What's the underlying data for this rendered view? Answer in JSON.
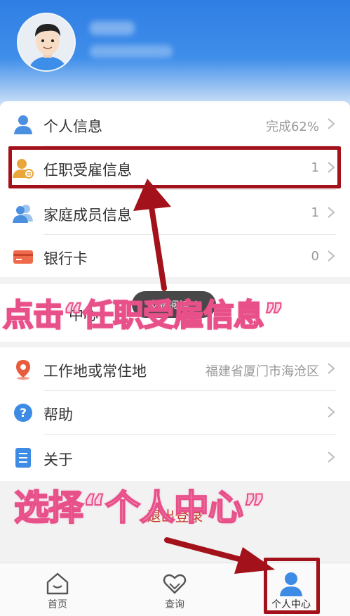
{
  "header": {
    "avatar": "user-avatar"
  },
  "menu_group1": [
    {
      "label": "个人信息",
      "value": "完成62%",
      "icon": "person-icon"
    },
    {
      "label": "任职受雇信息",
      "value": "1",
      "icon": "employment-icon"
    },
    {
      "label": "家庭成员信息",
      "value": "1",
      "icon": "family-icon"
    },
    {
      "label": "银行卡",
      "value": "0",
      "icon": "bank-card-icon"
    }
  ],
  "hidden_row_partial": "中心",
  "menu_group2": [
    {
      "label": "工作地或常住地",
      "value": "福建省厦门市海沧区",
      "icon": "location-icon"
    },
    {
      "label": "帮助",
      "value": "",
      "icon": "help-icon"
    },
    {
      "label": "关于",
      "value": "",
      "icon": "about-icon"
    }
  ],
  "logout": "退出登录",
  "step_pill": "步骤阅读",
  "overlays": {
    "click_instruction": "点击“任职受雇信息”",
    "choose_instruction": "选择“个人中心”"
  },
  "tabbar": [
    {
      "label": "首页",
      "icon": "home-icon"
    },
    {
      "label": "查询",
      "icon": "heart-search-icon"
    },
    {
      "label": "个人中心",
      "icon": "person-center-icon"
    }
  ],
  "colors": {
    "header_blue": "#2f7ee4",
    "annotation_red": "#a3111a",
    "overlay_pink": "#e8508a",
    "logout_red": "#c53a2a"
  }
}
